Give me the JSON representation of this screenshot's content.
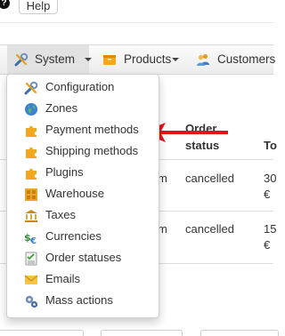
{
  "topbar": {
    "help_label": "Help"
  },
  "nav": {
    "system_label": "System",
    "products_label": "Products",
    "customers_label": "Customers"
  },
  "table": {
    "headers": {
      "order_status_line1": "Order",
      "order_status_line2": "status",
      "total_partial": "To"
    },
    "rows": [
      {
        "name_partial": "m",
        "status": "cancelled",
        "total_line1": "30",
        "total_line2": "€"
      },
      {
        "name_partial": "m",
        "status": "cancelled",
        "total_line1": "15",
        "total_line2": "€"
      }
    ]
  },
  "dropdown": {
    "items": [
      {
        "label": "Configuration",
        "icon": "wrench-screwdriver-icon"
      },
      {
        "label": "Zones",
        "icon": "globe-icon"
      },
      {
        "label": "Payment methods",
        "icon": "puzzle-icon"
      },
      {
        "label": "Shipping methods",
        "icon": "puzzle-icon"
      },
      {
        "label": "Plugins",
        "icon": "puzzle-icon"
      },
      {
        "label": "Warehouse",
        "icon": "warehouse-icon"
      },
      {
        "label": "Taxes",
        "icon": "bank-icon"
      },
      {
        "label": "Currencies",
        "icon": "currency-icon"
      },
      {
        "label": "Order statuses",
        "icon": "checklist-icon"
      },
      {
        "label": "Emails",
        "icon": "envelope-icon"
      },
      {
        "label": "Mass actions",
        "icon": "gears-icon"
      }
    ]
  },
  "colors": {
    "arrow": "#e8111b",
    "puzzle": "#f4a81d",
    "navbar_active": "#e2e2e2"
  }
}
